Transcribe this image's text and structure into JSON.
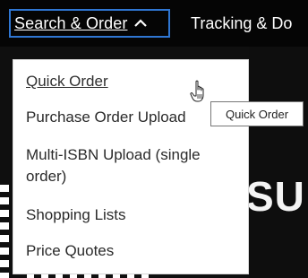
{
  "nav": {
    "active_label": "Search & Order",
    "next_label": "Tracking & Do"
  },
  "dropdown": {
    "items": [
      {
        "label": "Quick Order"
      },
      {
        "label": "Purchase Order Upload"
      },
      {
        "label": "Multi-ISBN Upload (single order)"
      },
      {
        "label": "Shopping Lists"
      },
      {
        "label": "Price Quotes"
      }
    ]
  },
  "tooltip": {
    "text": "Quick Order"
  },
  "background": {
    "big_text": "SU"
  },
  "colors": {
    "focus_border": "#2f76d2",
    "topbar": "#050505",
    "menu_bg": "#ffffff"
  },
  "icons": {
    "caret": "chevron-up-icon",
    "cursor": "hand-pointer-icon"
  }
}
